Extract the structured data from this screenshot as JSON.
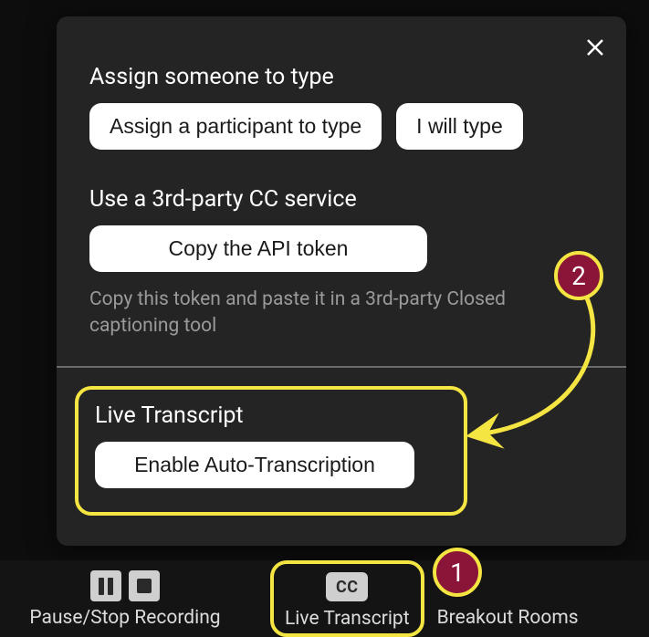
{
  "panel": {
    "section_assign": {
      "heading": "Assign someone to type",
      "assign_participant_btn": "Assign a participant to type",
      "i_will_type_btn": "I will type"
    },
    "section_3rdparty": {
      "heading": "Use a 3rd-party CC service",
      "copy_btn": "Copy the API token",
      "hint": "Copy this token and paste it in a 3rd-party Closed captioning tool"
    },
    "section_live": {
      "heading": "Live Transcript",
      "enable_btn": "Enable Auto-Transcription"
    }
  },
  "toolbar": {
    "record": {
      "label": "Pause/Stop Recording"
    },
    "cc": {
      "badge": "CC",
      "label": "Live Transcript"
    },
    "breakout": {
      "label": "Breakout Rooms"
    }
  },
  "annotations": {
    "step1": "1",
    "step2": "2"
  }
}
